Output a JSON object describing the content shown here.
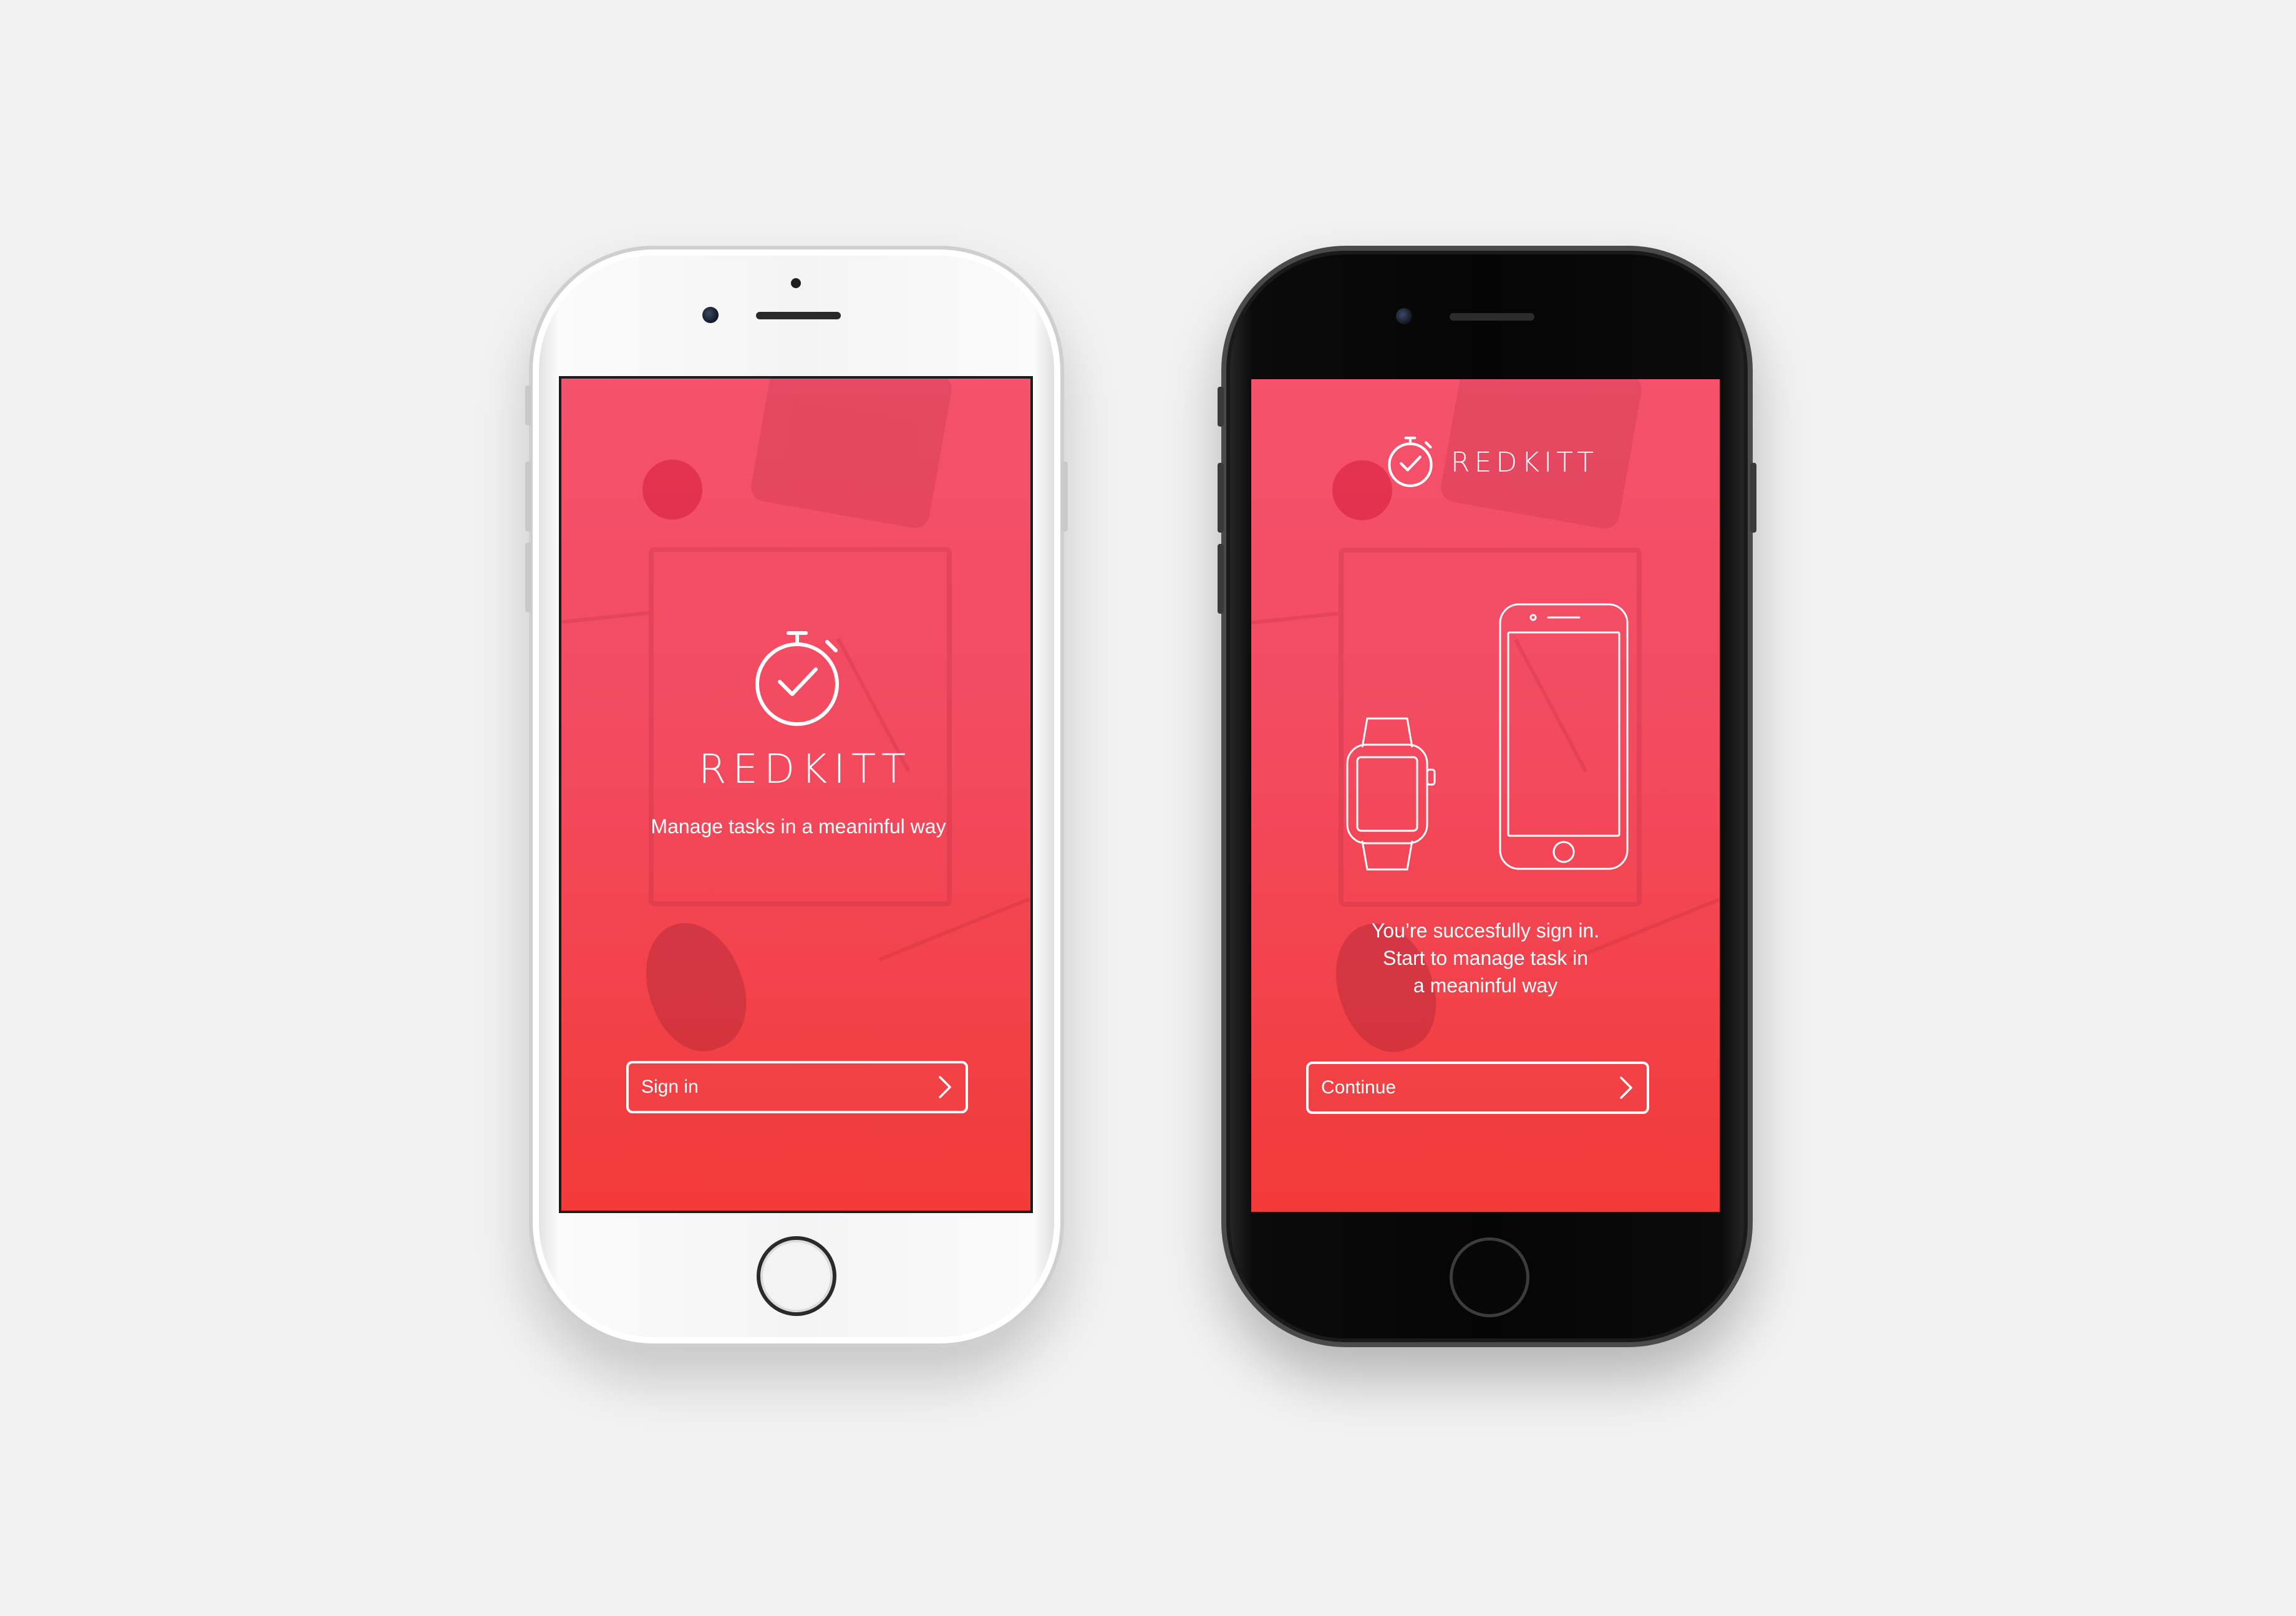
{
  "app": {
    "brand_name": "REDKITT",
    "accent_color": "#f2444f",
    "icon": "stopwatch-check-icon"
  },
  "screen_welcome": {
    "brand": "REDKITT",
    "tagline": "Manage tasks in a meaninful way",
    "cta_label": "Sign in",
    "cta_icon": "chevron-right-icon"
  },
  "screen_success": {
    "brand": "REDKITT",
    "illustration": [
      "watch-outline-icon",
      "phone-outline-icon"
    ],
    "message_lines": [
      "You’re succesfully sign in.",
      "Start to manage task in",
      "a meaninful way"
    ],
    "cta_label": "Continue",
    "cta_icon": "chevron-right-icon"
  }
}
